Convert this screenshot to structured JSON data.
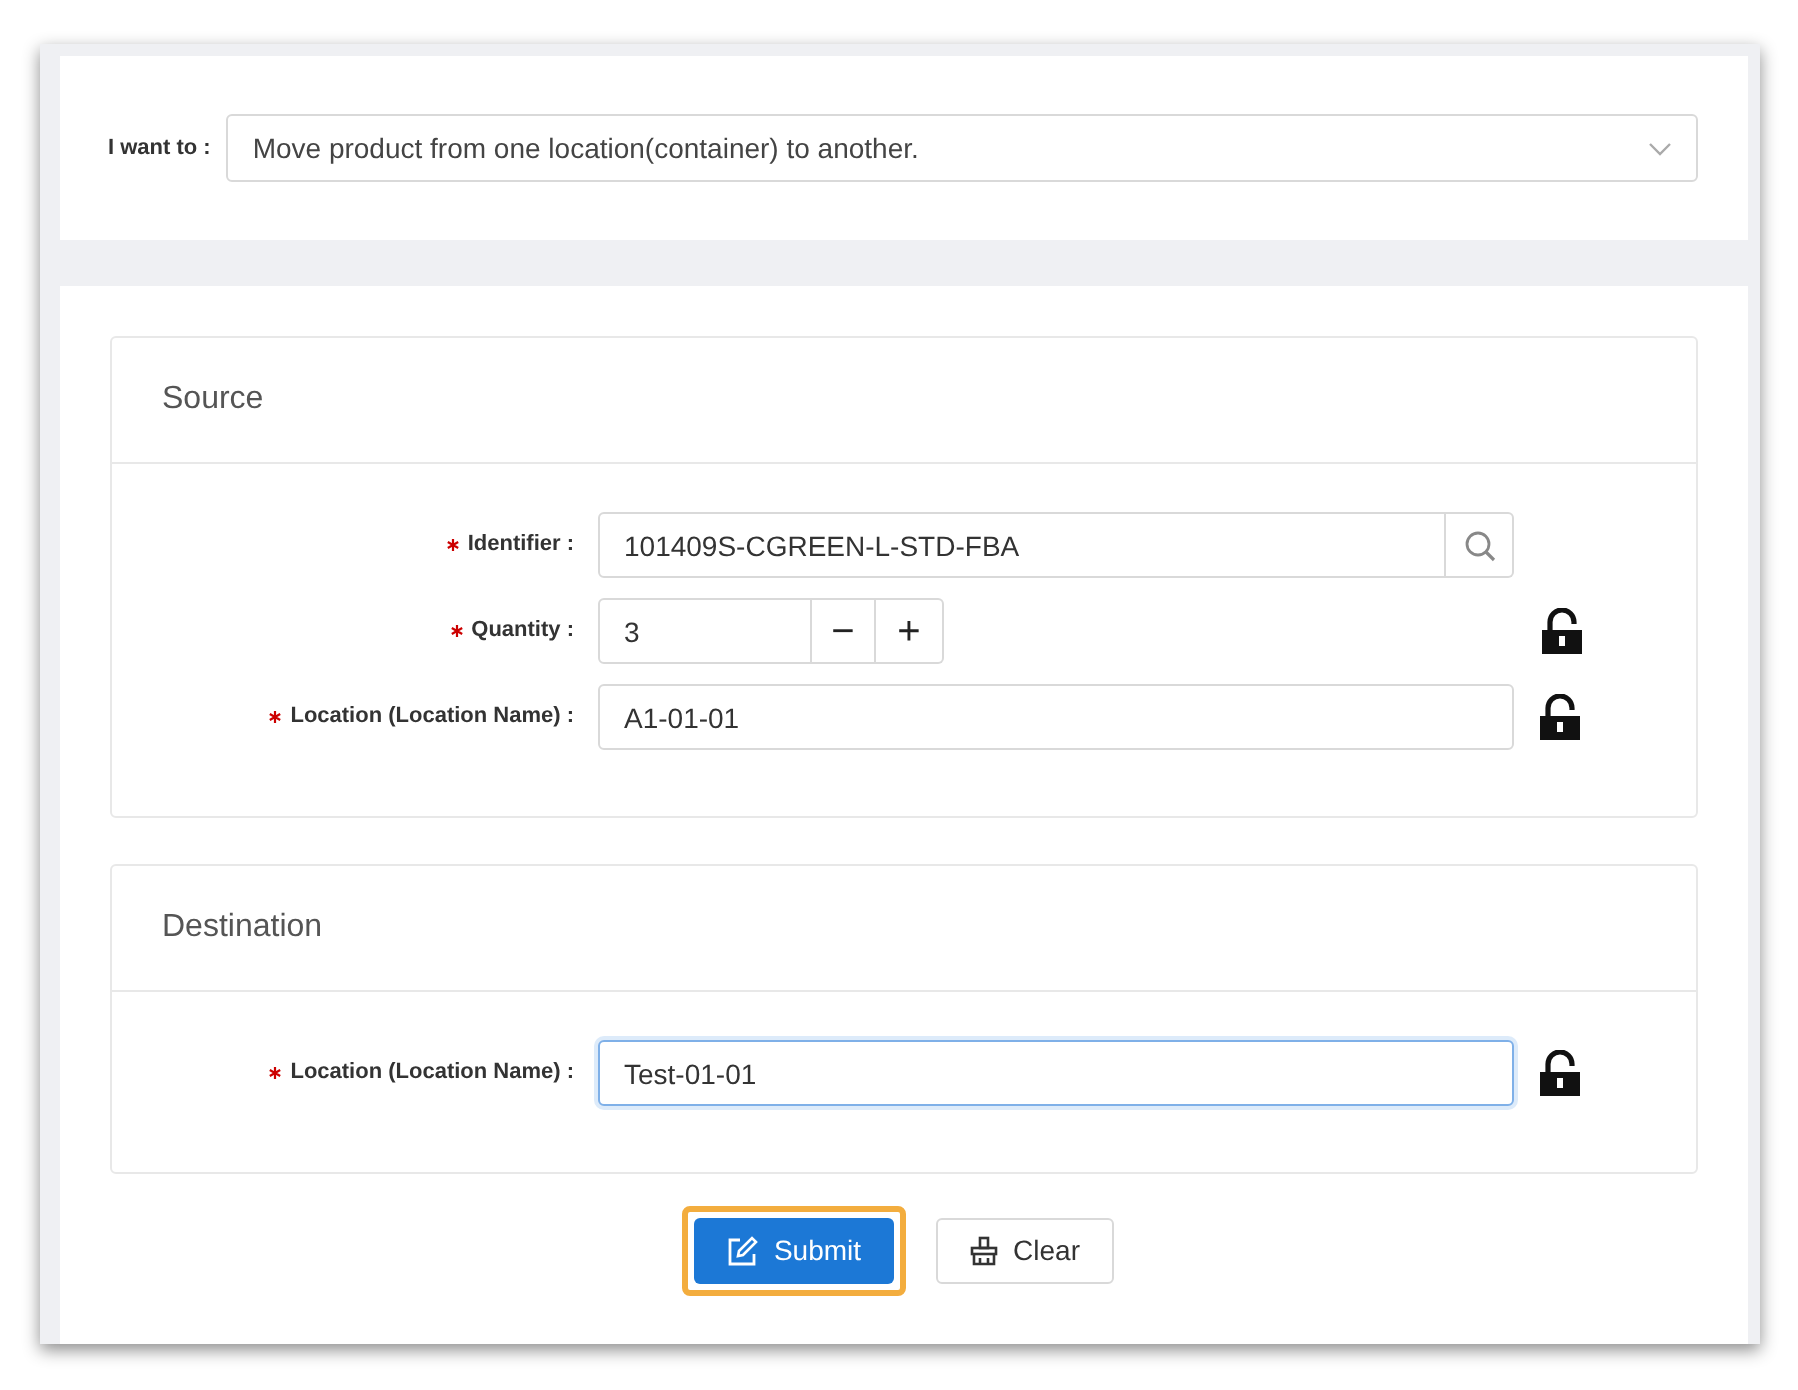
{
  "intent": {
    "label": "I want to :",
    "value": "Move product from one location(container) to another."
  },
  "sections": [
    {
      "title": "Source",
      "fields": [
        {
          "kind": "search",
          "label": "Identifier :",
          "required": true,
          "value": "101409S-CGREEN-L-STD-FBA",
          "focused": false
        },
        {
          "kind": "stepper",
          "label": "Quantity :",
          "required": true,
          "value": "3",
          "focused": false,
          "locked": false,
          "minus": "−",
          "plus": "+"
        },
        {
          "kind": "text",
          "label": "Location (Location Name) :",
          "required": true,
          "value": "A1-01-01",
          "focused": false,
          "locked": false
        }
      ]
    },
    {
      "title": "Destination",
      "fields": [
        {
          "kind": "text",
          "label": "Location (Location Name) :",
          "required": true,
          "value": "Test-01-01",
          "focused": true,
          "locked": false
        }
      ]
    }
  ],
  "buttons": [
    {
      "kind": "submit",
      "label": "Submit",
      "highlighted": true
    },
    {
      "kind": "clear",
      "label": "Clear",
      "highlighted": false
    }
  ]
}
